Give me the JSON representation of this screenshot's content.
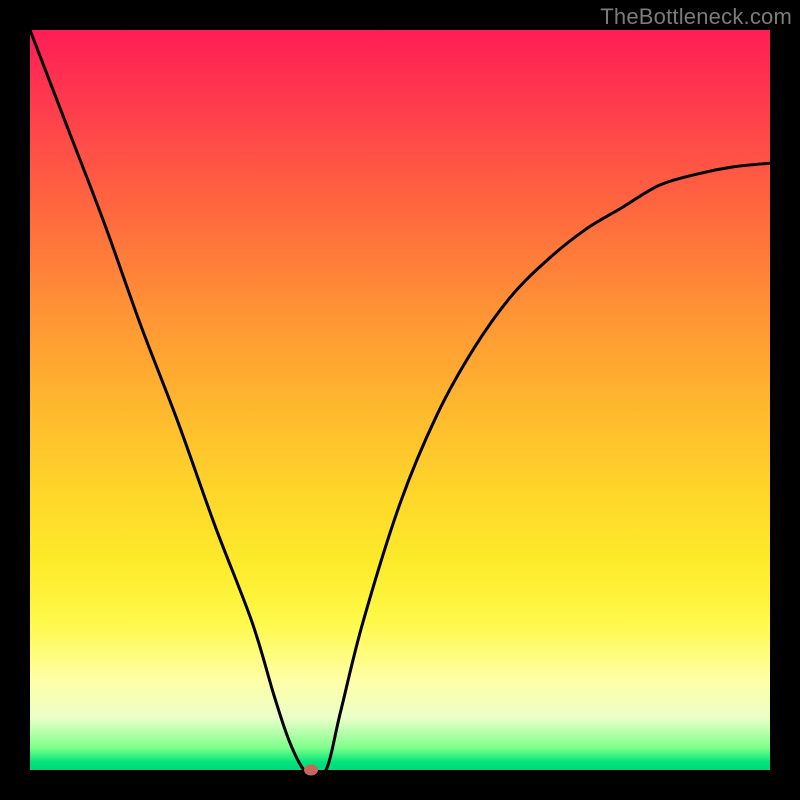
{
  "watermark": "TheBottleneck.com",
  "chart_data": {
    "type": "line",
    "title": "",
    "xlabel": "",
    "ylabel": "",
    "xlim": [
      0,
      100
    ],
    "ylim": [
      0,
      100
    ],
    "grid": false,
    "legend": false,
    "series": [
      {
        "name": "curve",
        "x": [
          0,
          5,
          10,
          15,
          20,
          25,
          30,
          33,
          35,
          37,
          38,
          40,
          42,
          45,
          50,
          55,
          60,
          65,
          70,
          75,
          80,
          85,
          90,
          95,
          100
        ],
        "y": [
          100,
          87,
          74,
          60,
          47,
          33,
          20,
          10,
          4,
          0,
          0,
          0,
          8,
          20,
          36,
          48,
          57,
          64,
          69,
          73,
          76,
          79,
          80.5,
          81.5,
          82
        ]
      }
    ],
    "marker": {
      "x": 38,
      "y": 0,
      "color": "#c9675e"
    },
    "background_gradient": {
      "top": "#ff1d55",
      "mid": "#ffd52a",
      "bottom": "#00d77e"
    }
  }
}
